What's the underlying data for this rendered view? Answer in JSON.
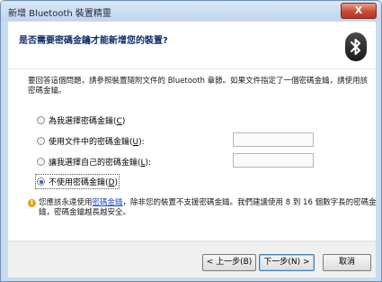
{
  "window": {
    "title": "新增 Bluetooth 裝置精靈",
    "close_label": "X"
  },
  "header": {
    "heading": "是否需要密碼金鑰才能新增您的裝置?"
  },
  "intro_text": "要回答這個問題，請參照裝置隨附文件的 Bluetooth 章節。如果文件指定了一個密碼金鑰，請使用該密碼金鑰。",
  "options": [
    {
      "label": "為我選擇密碼金鑰(",
      "key": "C",
      "suffix": ")"
    },
    {
      "label": "使用文件中的密碼金鑰(",
      "key": "U",
      "suffix": "):"
    },
    {
      "label": "讓我選擇自己的密碼金鑰(",
      "key": "L",
      "suffix": "):"
    },
    {
      "label": "不使用密碼金鑰(",
      "key": "D",
      "suffix": ")"
    }
  ],
  "selected_option": 3,
  "warning": {
    "pre": "您應該永遠使用",
    "link": "密碼金鑰",
    "post": "，除非您的裝置不支援密碼金鑰。我們建議使用 8 到 16 個數字長的密碼金鑰，密碼金鑰越長越安全。"
  },
  "buttons": {
    "back": "< 上一步(B)",
    "next": "下一步(N) >",
    "cancel": "取消"
  }
}
